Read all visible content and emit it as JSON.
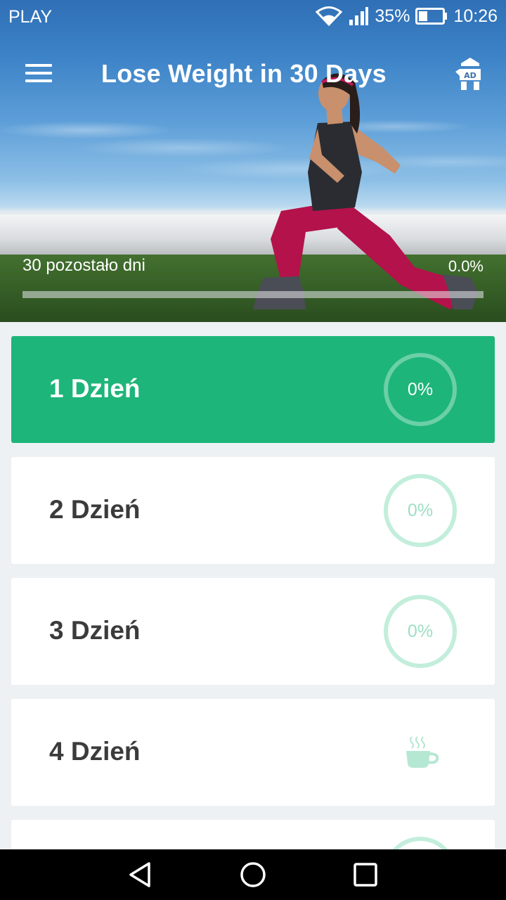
{
  "status_bar": {
    "carrier": "PLAY",
    "battery": "35%",
    "time": "10:26",
    "icons": [
      "wifi-icon",
      "signal-icon",
      "battery-icon"
    ]
  },
  "toolbar": {
    "title": "Lose Weight in 30 Days",
    "menu_icon": "hamburger-menu-icon",
    "ad_icon": "ad-tower-icon"
  },
  "hero": {
    "days_left": "30 pozostało dni",
    "progress_label": "0.0%",
    "progress_fraction": 0.0
  },
  "days": [
    {
      "label": "1 Dzień",
      "progress": "0%",
      "active": true,
      "rest": false
    },
    {
      "label": "2 Dzień",
      "progress": "0%",
      "active": false,
      "rest": false
    },
    {
      "label": "3 Dzień",
      "progress": "0%",
      "active": false,
      "rest": false
    },
    {
      "label": "4 Dzień",
      "progress": "",
      "active": false,
      "rest": true,
      "rest_icon": "coffee-cup-icon"
    }
  ],
  "colors": {
    "accent": "#1db57a",
    "ring": "#c2eedb",
    "ring_text": "#9ddfc3",
    "background": "#eef1f3"
  },
  "nav_bar": {
    "icons": [
      "back-icon",
      "home-icon",
      "recents-icon"
    ]
  }
}
